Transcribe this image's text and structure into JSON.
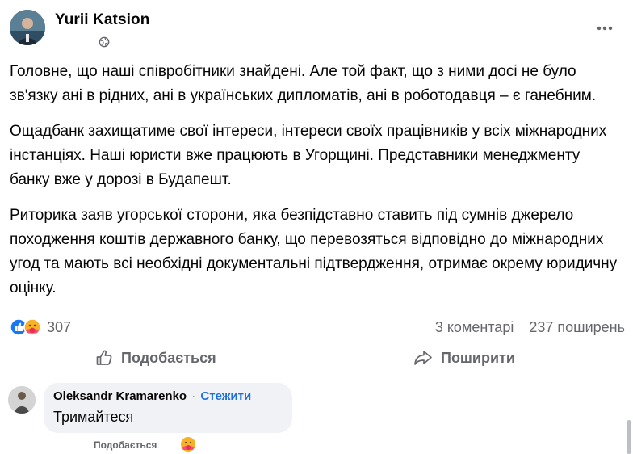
{
  "post": {
    "author": "Yurii Katsion",
    "privacy_icon": "globe-icon",
    "more_icon": "more-horizontal-icon",
    "paragraphs": [
      "Головне, що наші співробітники знайдені. Але той факт, що з ними досі не було зв'язку ані в рідних, ані в українських дипломатів, ані в роботодавця – є ганебним.",
      "Ощадбанк захищатиме свої інтереси, інтереси своїх працівників у всіх міжнародних інстанціях. Наші юристи вже працюють в Угорщині. Представники менеджменту банку вже у дорозі в Будапешт.",
      "Риторика заяв угорської сторони, яка безпідставно ставить під сумнів джерело походження коштів державного банку, що перевозяться відповідно до міжнародних угод та мають всі необхідні документальні підтвердження, отримає окрему юридичну оцінку."
    ],
    "reaction_count": "307",
    "comments_count": "3 коментарі",
    "shares_count": "237 поширень",
    "like_label": "Подобається",
    "share_label": "Поширити",
    "colors": {
      "like_blue": "#1877f2",
      "care_yellow": "#f7b125",
      "link": "#216fdb",
      "muted": "#65676b"
    }
  },
  "comment": {
    "author": "Oleksandr Kramarenko",
    "separator": "·",
    "follow_label": "Стежити",
    "text": "Тримайтеся",
    "like_label": "Подобається",
    "reaction_icon": "care-reaction-icon"
  }
}
